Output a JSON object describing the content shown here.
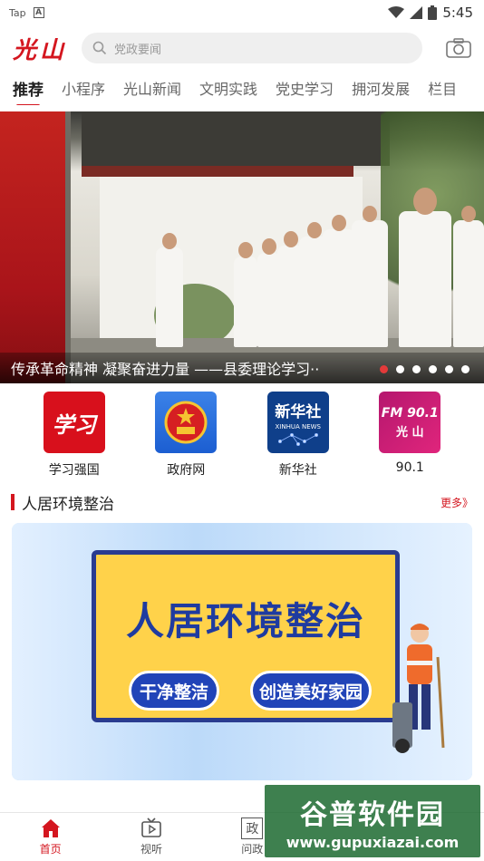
{
  "status_bar": {
    "left_items": [
      "Tap",
      "A"
    ],
    "time": "5:45"
  },
  "header": {
    "logo": "光山",
    "search_placeholder": "党政要闻",
    "camera_icon": "camera-icon"
  },
  "tabs": [
    {
      "label": "推荐",
      "active": true
    },
    {
      "label": "小程序",
      "active": false
    },
    {
      "label": "光山新闻",
      "active": false
    },
    {
      "label": "文明实践",
      "active": false
    },
    {
      "label": "党史学习",
      "active": false
    },
    {
      "label": "拥河发展",
      "active": false
    },
    {
      "label": "栏目",
      "active": false
    }
  ],
  "banner": {
    "caption": "传承革命精神  凝聚奋进力量  ——县委理论学习··",
    "slides": 6,
    "active_slide": 1
  },
  "shortcuts": [
    {
      "label": "学习强国",
      "icon_text": "学习"
    },
    {
      "label": "政府网",
      "icon_text": ""
    },
    {
      "label": "新华社",
      "icon_text": "新华社",
      "icon_subtext": "XINHUA NEWS"
    },
    {
      "label": "90.1",
      "icon_text": "FM 90.1",
      "icon_subtext": "光 山"
    }
  ],
  "section": {
    "title": "人居环境整治",
    "more": "更多》"
  },
  "feature": {
    "title": "人居环境整治",
    "pill_left": "干净整洁",
    "pill_right": "创造美好家园"
  },
  "bottom_nav": [
    {
      "label": "首页",
      "active": true,
      "icon": "home-icon"
    },
    {
      "label": "视听",
      "active": false,
      "icon": "tv-icon"
    },
    {
      "label": "问政",
      "active": false,
      "icon": "zheng-icon",
      "icon_text": "政"
    }
  ],
  "watermark": {
    "title": "谷普软件园",
    "url": "www.gupuxiazai.com"
  },
  "colors": {
    "brand": "#d4161f",
    "search_bg": "#efefef"
  }
}
